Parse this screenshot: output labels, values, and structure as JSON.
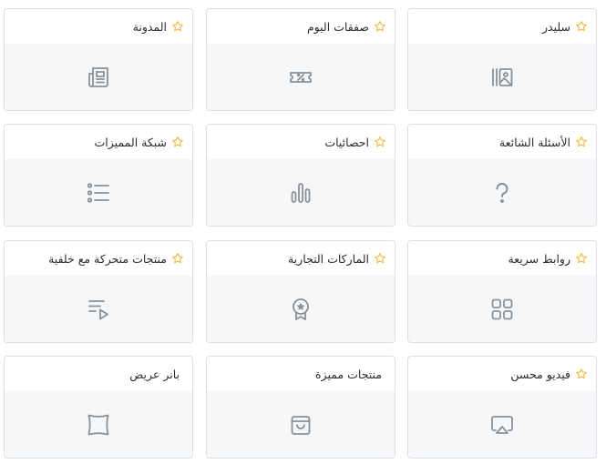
{
  "colors": {
    "star": "#f2b632",
    "icon": "#8b8f97",
    "border": "#dcdfe4",
    "body_bg": "#f6f7f9",
    "title": "#2a2d33"
  },
  "widgets": [
    {
      "title": "سليدر",
      "icon": "gallery-icon",
      "starred": true
    },
    {
      "title": "صفقات اليوم",
      "icon": "discount-ticket-icon",
      "starred": true
    },
    {
      "title": "المدونة",
      "icon": "newspaper-icon",
      "starred": true
    },
    {
      "title": "الأسئلة الشائعة",
      "icon": "question-icon",
      "starred": true
    },
    {
      "title": "احصائيات",
      "icon": "bar-chart-icon",
      "starred": true
    },
    {
      "title": "شبكة المميزات",
      "icon": "list-icon",
      "starred": true
    },
    {
      "title": "روابط سريعة",
      "icon": "grid-icon",
      "starred": true
    },
    {
      "title": "الماركات التجارية",
      "icon": "badge-icon",
      "starred": true
    },
    {
      "title": "منتجات متحركة مع خلفية",
      "icon": "playlist-icon",
      "starred": true
    },
    {
      "title": "فيديو محسن",
      "icon": "airplay-icon",
      "starred": true
    },
    {
      "title": "منتجات مميزة",
      "icon": "shopping-bag-icon",
      "starred": false
    },
    {
      "title": "بانر عريض",
      "icon": "banner-icon",
      "starred": false
    }
  ]
}
